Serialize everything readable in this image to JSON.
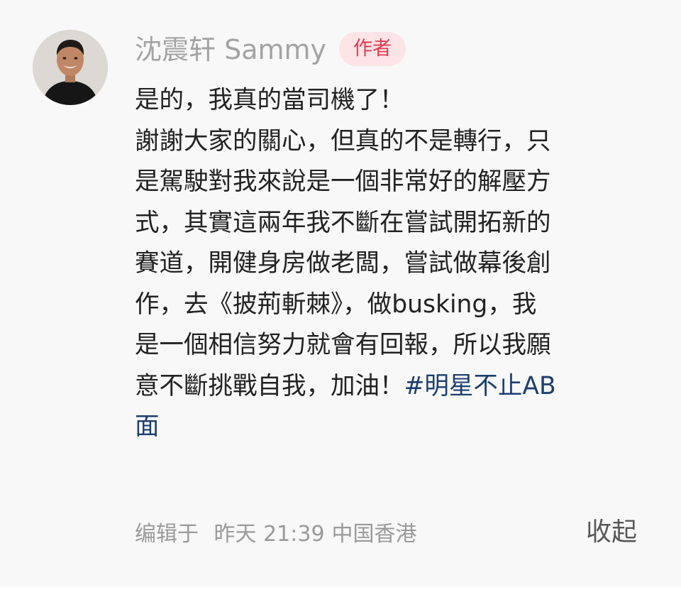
{
  "comment": {
    "author_name": "沈震轩 Sammy",
    "author_badge": "作者",
    "avatar": "avatar-person-black-shirt",
    "content_lines": [
      "是的，我真的當司機了！",
      "謝謝大家的關心，但真的不是轉行，只",
      "是駕駛對我來說是一個非常好的解壓方",
      "式，其實這兩年我不斷在嘗試開拓新的",
      "賽道，開健身房做老闆，嘗試做幕後創",
      "作，去《披荊斬棘》，做busking，我",
      "是一個相信努力就會有回報，所以我願",
      "意不斷挑戰自我，加油！"
    ],
    "hashtag_part1": "#明星不止AB",
    "hashtag_part2": "面",
    "meta": {
      "edited_label": "编辑于",
      "time": "昨天 21:39",
      "location": "中国香港"
    },
    "collapse_label": "收起"
  },
  "colors": {
    "background": "#f8f8f8",
    "author_name": "#a3a3a3",
    "badge_bg": "#fde4e7",
    "badge_text": "#e23a50",
    "hashtag": "#1d3f6e",
    "body_text": "#222222",
    "meta_text": "#9a9a9a"
  }
}
